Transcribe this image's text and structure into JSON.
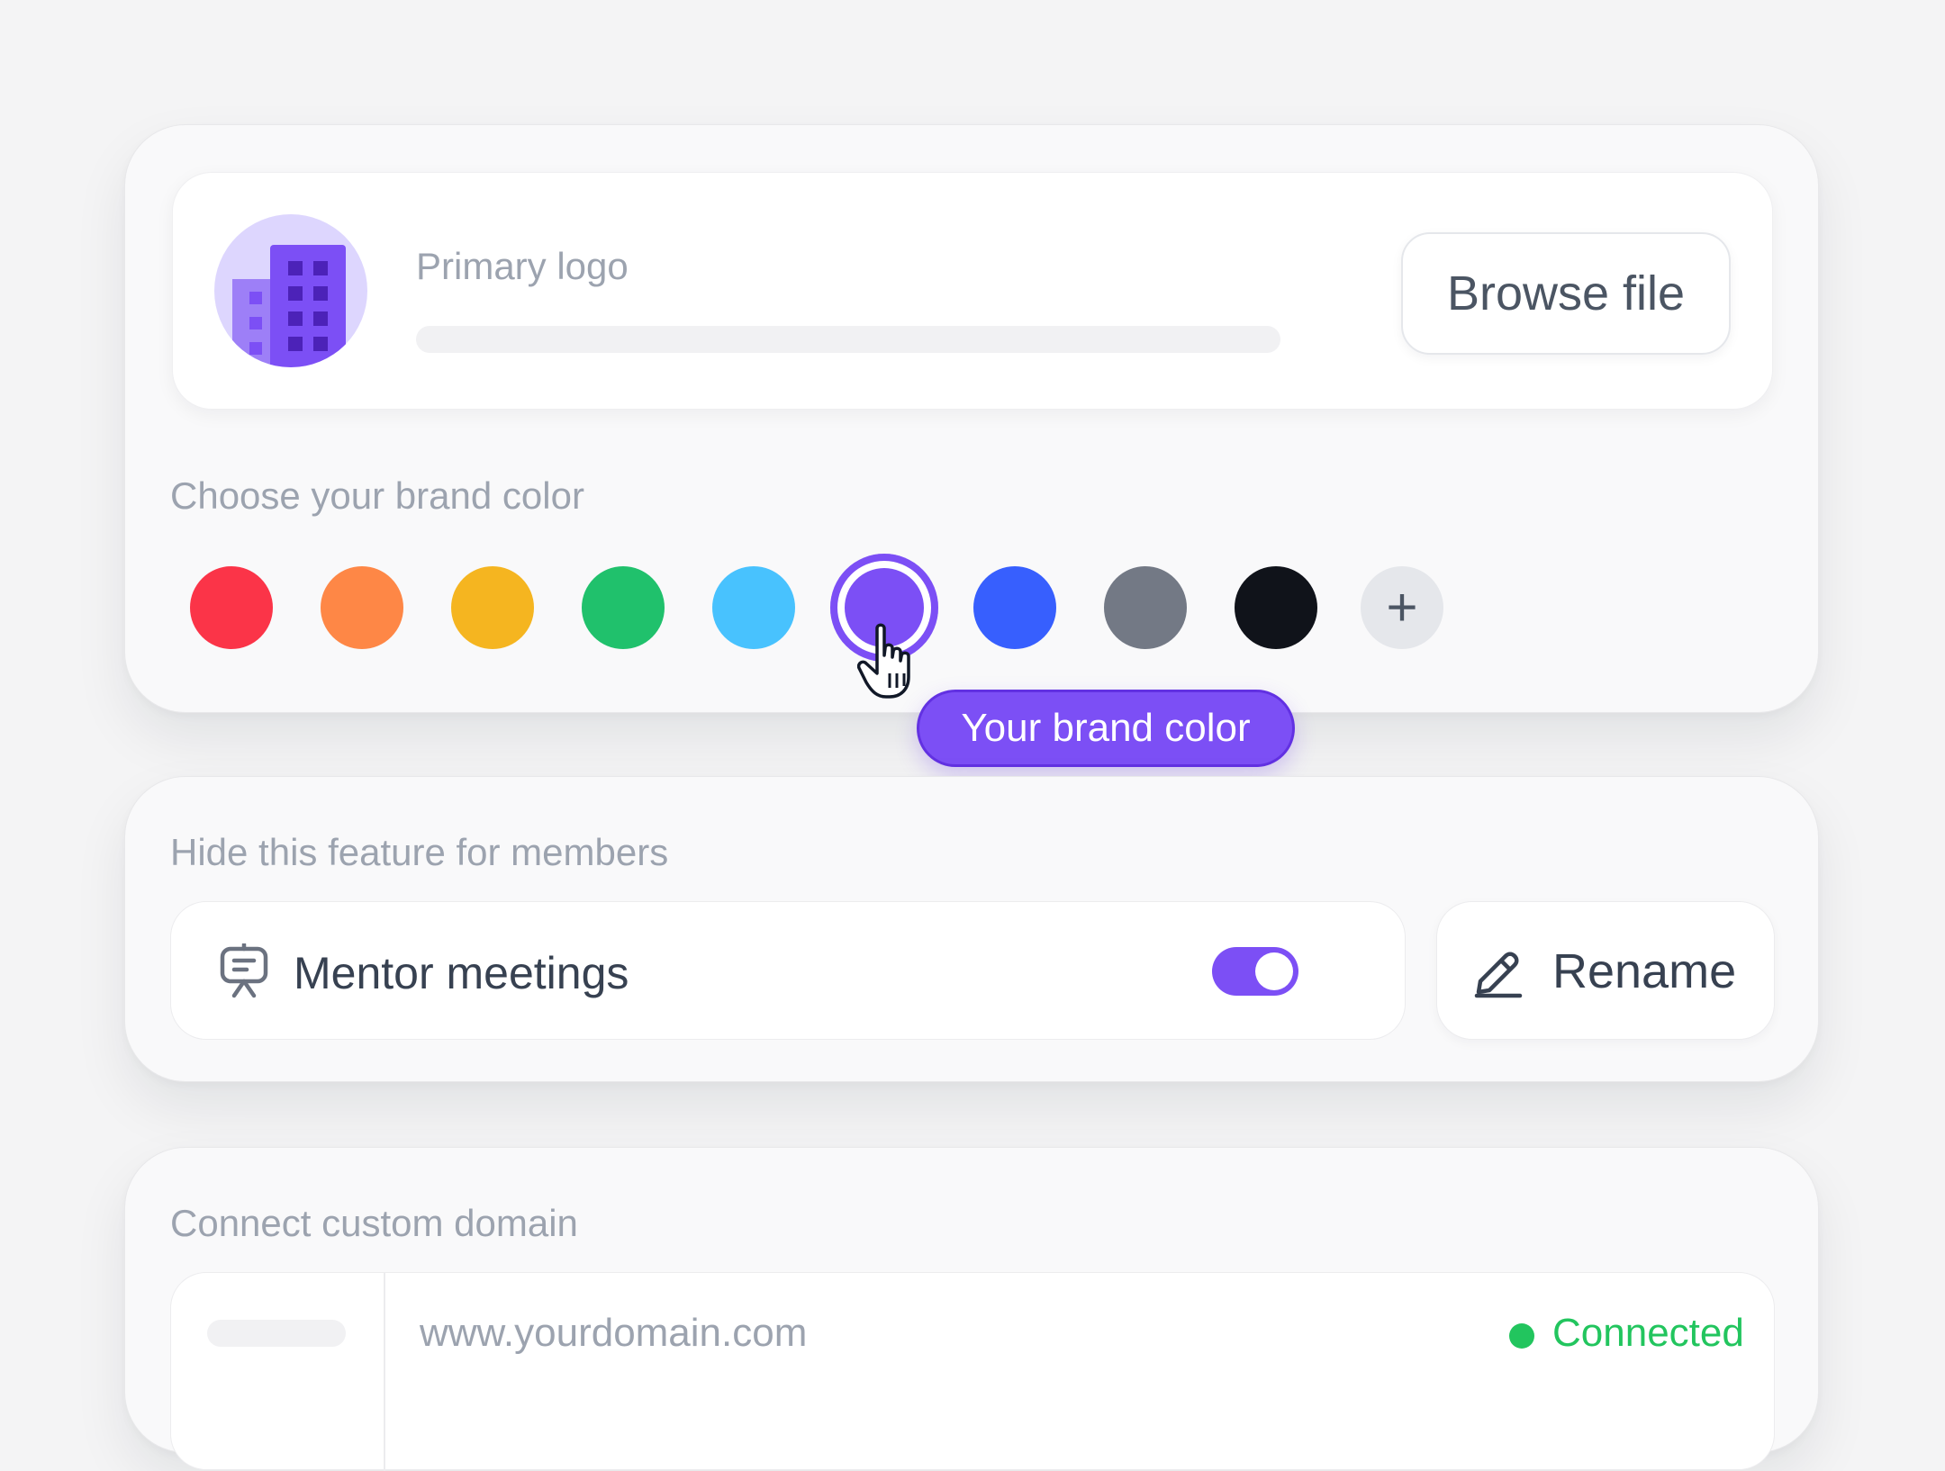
{
  "branding": {
    "primary_logo_label": "Primary logo",
    "browse_button_label": "Browse file",
    "brand_color_label": "Choose your brand color",
    "colors": [
      {
        "name": "red",
        "hex": "#fb3448"
      },
      {
        "name": "orange",
        "hex": "#fe8746"
      },
      {
        "name": "yellow",
        "hex": "#f5b520"
      },
      {
        "name": "green",
        "hex": "#20c16c"
      },
      {
        "name": "light-blue",
        "hex": "#48c2fe"
      },
      {
        "name": "purple",
        "hex": "#7c4ff5",
        "selected": true
      },
      {
        "name": "blue",
        "hex": "#375ffe"
      },
      {
        "name": "gray",
        "hex": "#737985"
      },
      {
        "name": "black",
        "hex": "#10131a"
      }
    ],
    "add_color_symbol": "+",
    "tooltip": "Your brand color",
    "accent": "#7c4ff5"
  },
  "feature_visibility": {
    "label": "Hide this feature for members",
    "feature_name": "Mentor meetings",
    "feature_icon": "presentation-icon",
    "toggle_on": true,
    "rename_label": "Rename",
    "rename_icon": "pencil-icon"
  },
  "domain": {
    "label": "Connect custom domain",
    "url": "www.yourdomain.com",
    "status": "Connected",
    "status_color": "#22c55e"
  }
}
